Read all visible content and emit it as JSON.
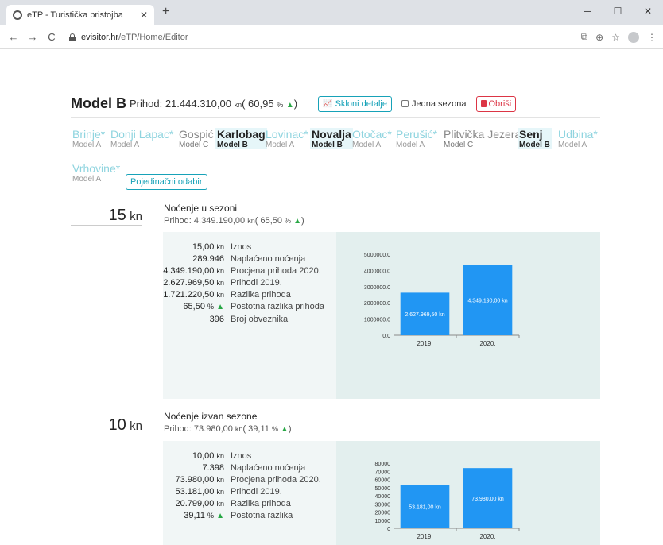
{
  "browser": {
    "tab_title": "eTP - Turistička pristojba",
    "url_host": "evisitor.hr",
    "url_path": "/eTP/Home/Editor"
  },
  "model": {
    "name": "Model B",
    "prihod_label": "Prihod:",
    "prihod_value": "21.444.310,00",
    "kn": "kn",
    "percent": "( 60,95",
    "percent_sign": "%",
    "close_paren": ")",
    "skloni_detalje": "Skloni detalje",
    "jedna_sezona": "Jedna sezona",
    "obrisi": "Obriši"
  },
  "cities": [
    {
      "name": "Brinje*",
      "model": "Model A"
    },
    {
      "name": "Donji Lapac*",
      "model": "Model A"
    },
    {
      "name": "Gospić",
      "model": "Model C"
    },
    {
      "name": "Karlobag",
      "model": "Model B"
    },
    {
      "name": "Lovinac*",
      "model": "Model A"
    },
    {
      "name": "Novalja",
      "model": "Model B"
    },
    {
      "name": "Otočac*",
      "model": "Model A"
    },
    {
      "name": "Perušić*",
      "model": "Model A"
    },
    {
      "name": "Plitvička Jezera",
      "model": "Model C"
    },
    {
      "name": "Senj",
      "model": "Model B"
    },
    {
      "name": "Udbina*",
      "model": "Model A"
    },
    {
      "name": "Vrhovine*",
      "model": "Model A"
    }
  ],
  "pojedinacni": "Pojedinačni odabir",
  "sections": [
    {
      "price": "15",
      "kn": "kn",
      "title": "Noćenje u sezoni",
      "prihod_label": "Prihod:",
      "prihod_value": "4.349.190,00",
      "percent": "( 65,50",
      "rows": [
        {
          "v": "15,00",
          "vkn": "kn",
          "l": "Iznos"
        },
        {
          "v": "289.946",
          "vkn": "",
          "l": "Naplaćeno noćenja"
        },
        {
          "v": "4.349.190,00",
          "vkn": "kn",
          "l": "Procjena prihoda 2020."
        },
        {
          "v": "2.627.969,50",
          "vkn": "kn",
          "l": "Prihodi 2019."
        },
        {
          "v": "1.721.220,50",
          "vkn": "kn",
          "l": "Razlika prihoda"
        },
        {
          "v": "65,50",
          "vkn": "%",
          "l": "Postotna razlika prihoda"
        },
        {
          "v": "396",
          "vkn": "",
          "l": "Broj obveznika"
        }
      ]
    },
    {
      "price": "10",
      "kn": "kn",
      "title": "Noćenje izvan sezone",
      "prihod_label": "Prihod:",
      "prihod_value": "73.980,00",
      "percent": "( 39,11",
      "rows": [
        {
          "v": "10,00",
          "vkn": "kn",
          "l": "Iznos"
        },
        {
          "v": "7.398",
          "vkn": "",
          "l": "Naplaćeno noćenja"
        },
        {
          "v": "73.980,00",
          "vkn": "kn",
          "l": "Procjena prihoda 2020."
        },
        {
          "v": "53.181,00",
          "vkn": "kn",
          "l": "Prihodi 2019."
        },
        {
          "v": "20.799,00",
          "vkn": "kn",
          "l": "Razlika prihoda"
        },
        {
          "v": "39,11",
          "vkn": "%",
          "l": "Postotna razlika"
        }
      ]
    }
  ],
  "chart_data": [
    {
      "type": "bar",
      "categories": [
        "2019.",
        "2020."
      ],
      "values": [
        2627969.5,
        4349190.0
      ],
      "data_labels": [
        "2.627.969,50 kn",
        "4.349.190,00 kn"
      ],
      "yticks": [
        "0.0",
        "1000000.0",
        "2000000.0",
        "3000000.0",
        "4000000.0",
        "5000000.0"
      ],
      "ylim": [
        0,
        5000000
      ],
      "color": "#2196f3"
    },
    {
      "type": "bar",
      "categories": [
        "2019.",
        "2020."
      ],
      "values": [
        53181.0,
        73980.0
      ],
      "data_labels": [
        "53.181,00 kn",
        "73.980,00 kn"
      ],
      "yticks": [
        "0",
        "10000",
        "20000",
        "30000",
        "40000",
        "50000",
        "60000",
        "70000",
        "80000"
      ],
      "ylim": [
        0,
        80000
      ],
      "color": "#2196f3"
    }
  ]
}
